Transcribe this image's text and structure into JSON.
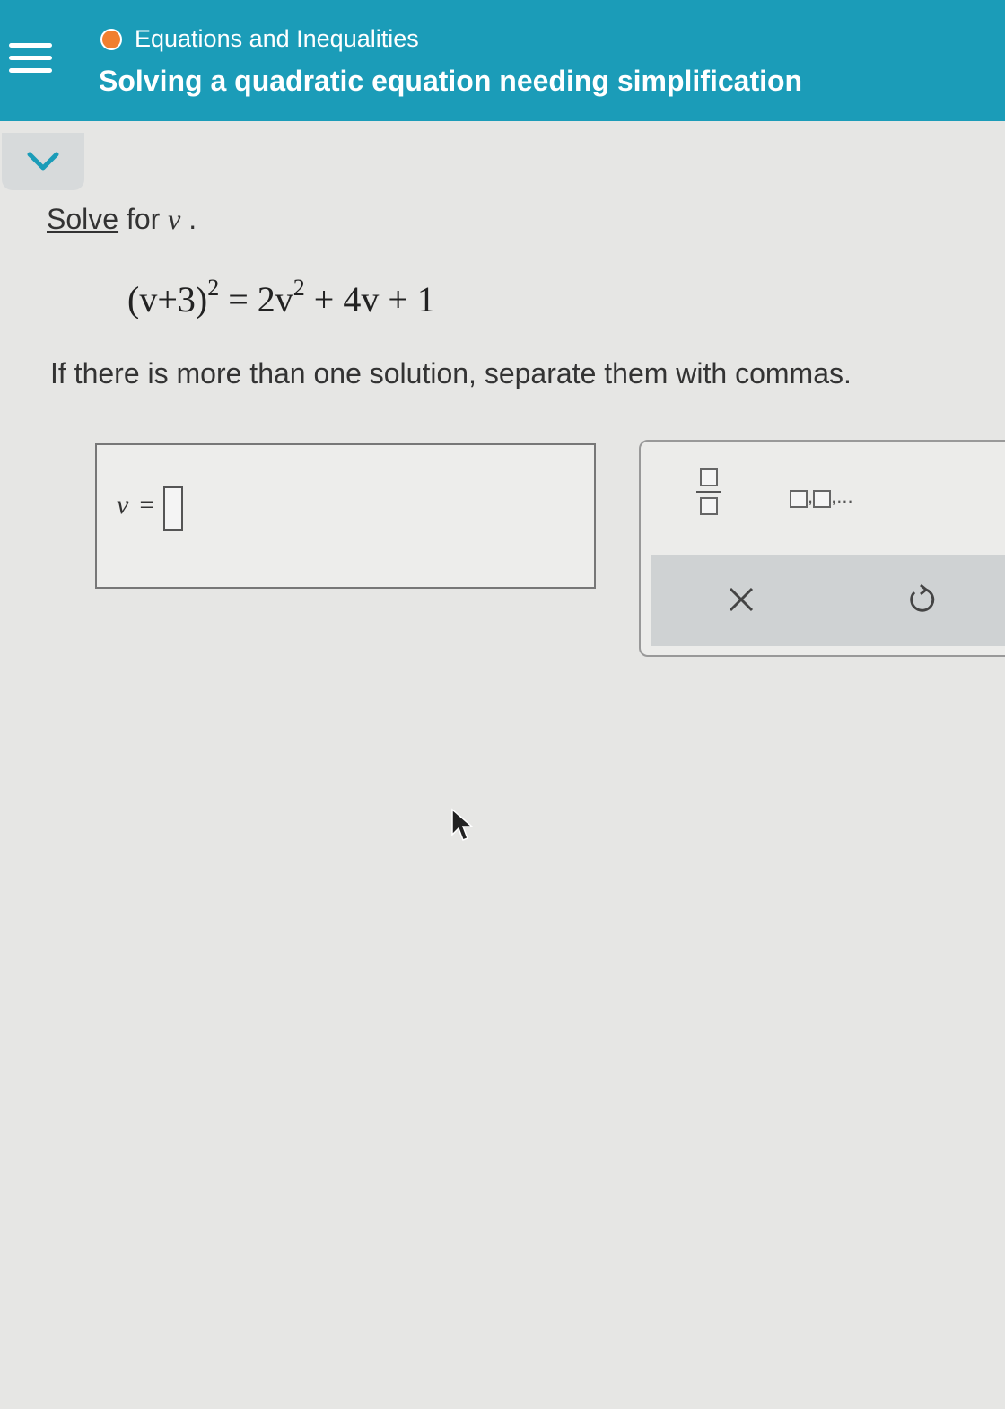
{
  "header": {
    "topic": "Equations and Inequalities",
    "title": "Solving a quadratic equation needing simplification",
    "menu_icon": "hamburger-menu-icon",
    "topic_status_color": "#f07f2f",
    "background_color": "#1b9cb8"
  },
  "collapse": {
    "icon": "chevron-down-icon"
  },
  "problem": {
    "solve_word": "Solve",
    "for_text": " for ",
    "variable": "v",
    "period": " .",
    "equation": {
      "lhs_base": "(v+3)",
      "lhs_exp": "2",
      "equals": " = ",
      "rhs_coef": "2v",
      "rhs_exp": "2",
      "rhs_rest": " + 4v + 1"
    },
    "instruction": "If there is more than one solution, separate them with commas."
  },
  "answer": {
    "variable": "v",
    "equals": "=",
    "value": ""
  },
  "keypad": {
    "list_key_text": ",...",
    "list_key_sep": ",",
    "fraction_icon": "fraction-icon",
    "clear_icon": "close-icon",
    "undo_icon": "undo-icon"
  }
}
